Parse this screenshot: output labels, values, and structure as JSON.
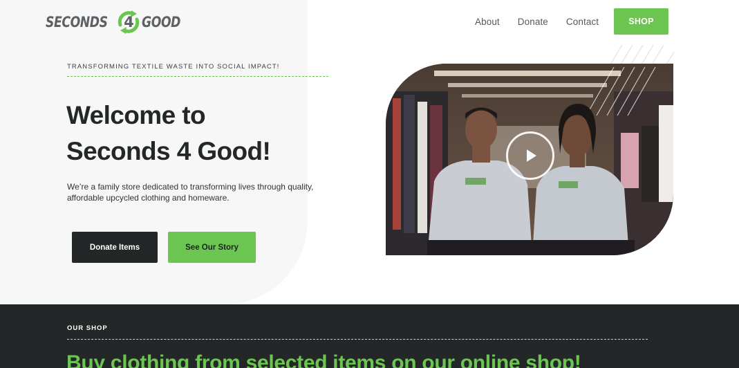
{
  "header": {
    "logo": {
      "word1": "SECONDS",
      "number": "4",
      "word2": "GOOD"
    },
    "nav": [
      {
        "label": "About"
      },
      {
        "label": "Donate"
      },
      {
        "label": "Contact"
      }
    ],
    "shop_label": "SHOP"
  },
  "hero": {
    "eyebrow": "TRANSFORMING TEXTILE WASTE INTO SOCIAL IMPACT!",
    "headline_line1": "Welcome to",
    "headline_line2": "Seconds 4 Good!",
    "description": "We’re a family store dedicated to transforming lives through quality, affordable upcycled clothing and homeware.",
    "donate_button": "Donate Items",
    "story_button": "See Our Story"
  },
  "video": {
    "play_icon": "play-icon"
  },
  "shop_section": {
    "eyebrow": "OUR SHOP",
    "title": "Buy clothing from selected items on our online shop!"
  },
  "colors": {
    "brand_green": "#6cc550",
    "dark": "#232728",
    "logo_gray": "#5c6165"
  }
}
